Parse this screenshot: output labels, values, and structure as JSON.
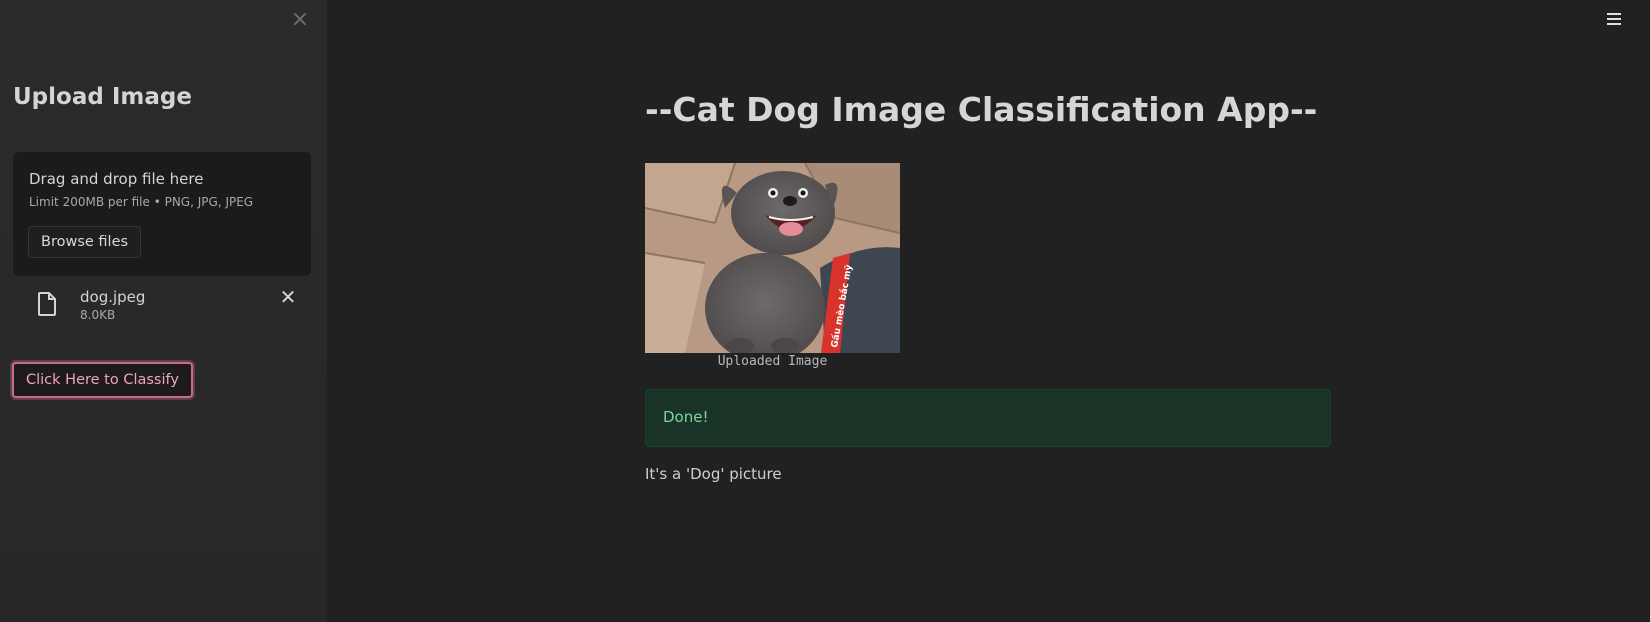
{
  "sidebar": {
    "close_icon": "close-icon",
    "title": "Upload Image",
    "uploader": {
      "drop_title": "Drag and drop file here",
      "limit_text": "Limit 200MB per file • PNG, JPG, JPEG",
      "browse_label": "Browse files"
    },
    "file": {
      "icon": "file-icon",
      "name": "dog.jpeg",
      "size": "8.0KB",
      "remove_icon": "close-icon"
    },
    "classify_label": "Click Here to Classify"
  },
  "header": {
    "menu_icon": "hamburger-menu-icon"
  },
  "main": {
    "title": "--Cat Dog Image Classification App--",
    "image": {
      "caption": "Uploaded Image",
      "overlay_text": "Gấu mèo bắc mỹ"
    },
    "status": "Done!",
    "result": "It's a 'Dog' picture"
  },
  "colors": {
    "background": "#212121",
    "sidebar": "#2b2b2b",
    "accent": "#c96b8d",
    "success_bg": "#1a3327",
    "success_text": "#7fd4a0"
  }
}
